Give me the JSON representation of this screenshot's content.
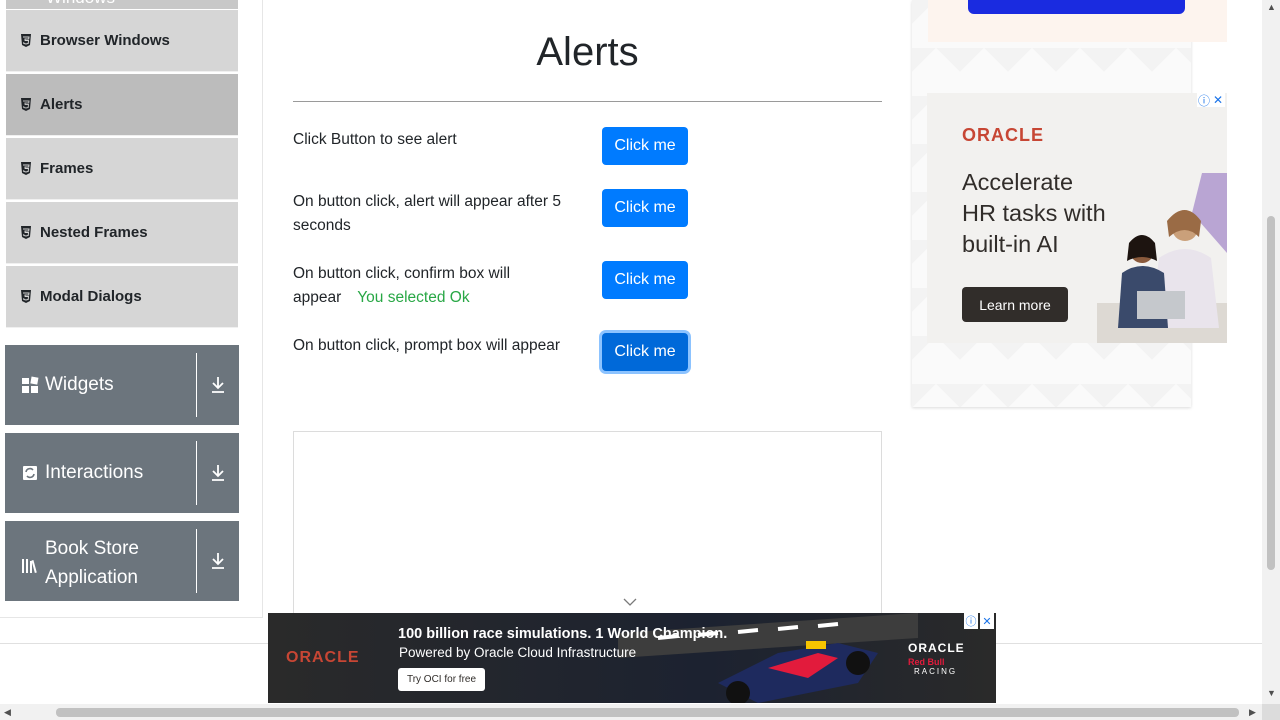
{
  "sidebar": {
    "partial_top_label": "Windows",
    "items": [
      {
        "label": "Browser Windows",
        "active": false
      },
      {
        "label": "Alerts",
        "active": true
      },
      {
        "label": "Frames",
        "active": false
      },
      {
        "label": "Nested Frames",
        "active": false
      },
      {
        "label": "Modal Dialogs",
        "active": false
      }
    ],
    "groups": [
      {
        "label": "Widgets",
        "icon": "widgets-icon"
      },
      {
        "label": "Interactions",
        "icon": "interactions-icon"
      },
      {
        "label": "Book Store Application",
        "label_line1": "Book Store",
        "label_line2": "Application",
        "icon": "books-icon"
      }
    ]
  },
  "main": {
    "title": "Alerts",
    "rows": [
      {
        "text": "Click Button to see alert",
        "button": "Click me"
      },
      {
        "text": "On button click, alert will appear after 5 seconds",
        "button": "Click me"
      },
      {
        "text": "On button click, confirm box will appear",
        "result": "You selected Ok",
        "button": "Click me"
      },
      {
        "text": "On button click, prompt box will appear",
        "button": "Click me",
        "focused": true
      }
    ]
  },
  "right_ad": {
    "brand": "ORACLE",
    "headline": "Accelerate HR tasks with built-in AI",
    "headline_l1": "Accelerate",
    "headline_l2": "HR tasks with",
    "headline_l3": "built-in AI",
    "cta": "Learn more"
  },
  "bottom_ad": {
    "brand": "ORACLE",
    "headline": "100 billion race simulations. 1 World Champion.",
    "sub": "Powered by Oracle Cloud Infrastructure",
    "cta": "Try OCI for free",
    "partner_brand": "ORACLE",
    "partner_sub": "Red Bull",
    "partner_racing": "RACING"
  },
  "colors": {
    "primary": "#007bff",
    "success": "#28a745",
    "sidebar_group": "#6c757d",
    "sidebar_item": "#d6d6d6",
    "oracle_red": "#c74634"
  }
}
